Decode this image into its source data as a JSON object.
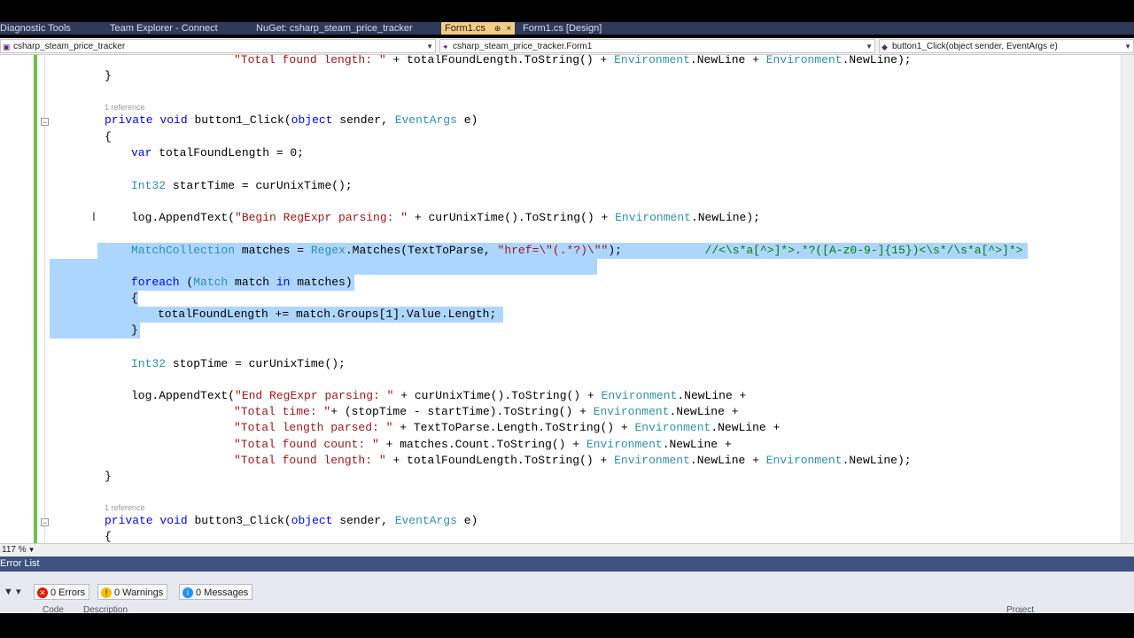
{
  "tabs": [
    "Diagnostic Tools",
    "Team Explorer - Connect",
    "NuGet: csharp_steam_price_tracker",
    "Form1.cs",
    "Form1.cs [Design]"
  ],
  "tab_active_pin": "⊕",
  "tab_close": "×",
  "nav": {
    "project": "csharp_steam_price_tracker",
    "class": "csharp_steam_price_tracker.Form1",
    "member": "button1_Click(object sender, EventArgs e)"
  },
  "editor": {
    "references": [
      "1 reference",
      "1 reference"
    ],
    "selected_lines": [
      6,
      8,
      9,
      10,
      11
    ]
  },
  "zoom": "117 %",
  "error_list": {
    "title": "Error List",
    "errors": "0 Errors",
    "warnings": "0 Warnings",
    "messages": "0 Messages",
    "col_code": "Code",
    "col_description": "Description",
    "col_project": "Project"
  },
  "colors": {
    "tab_active": "#f5cc84",
    "tab_strip": "#2d3a5a",
    "selection": "#add6ff",
    "keyword": "#0000ff",
    "type": "#2b91af",
    "string": "#a31515",
    "comment": "#008000",
    "change_bar": "#6cc24a",
    "error_list_title": "#3e5180"
  }
}
